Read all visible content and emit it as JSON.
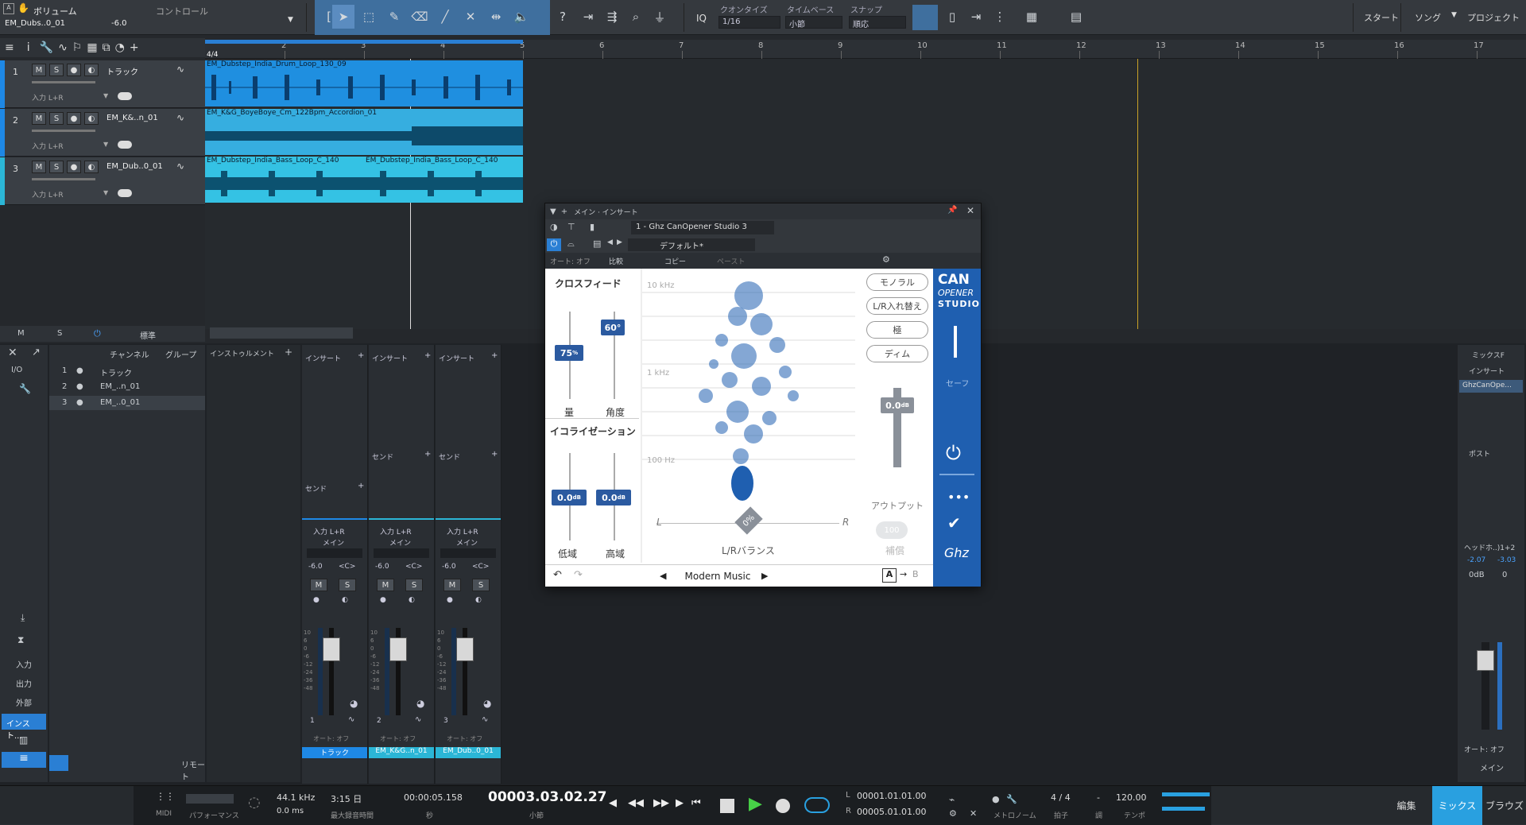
{
  "topbar": {
    "param_label": "ボリューム",
    "control_label": "コントロール",
    "track_label": "EM_Dubs..0_01",
    "param_value": "-6.0",
    "iq_label": "IQ",
    "quantize_label": "クオンタイズ",
    "quantize_value": "1/16",
    "timebase_label": "タイムベース",
    "timebase_value": "小節",
    "snap_label": "スナップ",
    "snap_value": "順応",
    "start_tab": "スタート",
    "song_tab": "ソング",
    "project_tab": "プロジェクト"
  },
  "ruler": {
    "bars": [
      "2",
      "3",
      "4",
      "5",
      "6",
      "7",
      "8",
      "9",
      "10",
      "11",
      "12",
      "13",
      "14",
      "15",
      "16",
      "17"
    ],
    "signature": "4/4"
  },
  "tracks": [
    {
      "num": "1",
      "name": "トラック",
      "input": "入力 L+R",
      "clips": [
        "EM_Dubstep_India_Drum_Loop_130_09"
      ]
    },
    {
      "num": "2",
      "name": "EM_K&..n_01",
      "input": "入力 L+R",
      "clips": [
        "EM_K&G_BoyeBoye_Cm_122Bpm_Accordion_01"
      ]
    },
    {
      "num": "3",
      "name": "EM_Dub..0_01",
      "input": "入力 L+R",
      "clips": [
        "EM_Dubstep_India_Bass_Loop_C_140",
        "EM_Dubstep_India_Bass_Loop_C_140"
      ]
    }
  ],
  "track_footer": {
    "m": "M",
    "s": "S",
    "std": "標準"
  },
  "mixer_left": {
    "io": "I/O",
    "col_channel": "チャンネル",
    "col_group": "グループ",
    "col_instrument": "インストゥルメント",
    "channels": [
      {
        "num": "1",
        "name": "トラック"
      },
      {
        "num": "2",
        "name": "EM_..n_01"
      },
      {
        "num": "3",
        "name": "EM_..0_01"
      }
    ],
    "nav": [
      "入力",
      "出力",
      "外部",
      "インスト...",
      "リモート"
    ]
  },
  "channels": [
    {
      "insert": "インサート",
      "send": "センド",
      "input": "入力 L+R",
      "out": "メイン",
      "vol": "-6.0",
      "pan": "<C>",
      "num": "1",
      "label": "トラック",
      "color": "#1e88e5"
    },
    {
      "insert": "インサート",
      "send": "センド",
      "input": "入力 L+R",
      "out": "メイン",
      "vol": "-6.0",
      "pan": "<C>",
      "num": "2",
      "label": "EM_K&G..n_01",
      "color": "#2bb6d6"
    },
    {
      "insert": "インサート",
      "send": "センド",
      "input": "入力 L+R",
      "out": "メイン",
      "vol": "-6.0",
      "pan": "<C>",
      "num": "3",
      "label": "EM_Dub..0_01",
      "color": "#2bb6d6"
    }
  ],
  "fader_scale": [
    "10",
    "6",
    "0",
    "-6",
    "-12",
    "-24",
    "-36",
    "-48"
  ],
  "main_channel": {
    "mix_label": "ミックスF",
    "insert": "インサート",
    "plugin_slot": "GhzCanOpe...",
    "post": "ポスト",
    "headphone": "ヘッドホ..)1+2",
    "l_val": "-2.07",
    "r_val": "-3.03",
    "db": "0dB",
    "db2": "0",
    "auto": "オート: オフ",
    "label": "メイン"
  },
  "plugin": {
    "title": "メイン · インサート",
    "instance": "1 - Ghz CanOpener Studio 3",
    "preset": "デフォルト*",
    "auto": "オート: オフ",
    "compare": "比較",
    "copy": "コピー",
    "paste": "ペースト",
    "crossfeed": "クロスフィード",
    "amount_val": "75",
    "amount_label": "量",
    "angle_val": "60°",
    "angle_label": "角度",
    "eq": "イコライゼーション",
    "low_val": "0.0",
    "low_label": "低域",
    "high_val": "0.0",
    "high_label": "高域",
    "freq_10k": "10 kHz",
    "freq_1k": "1 kHz",
    "freq_100": "100 Hz",
    "pill_mono": "モノラル",
    "pill_swap": "L/R入れ替え",
    "pill_polar": "極",
    "pill_dim": "ディム",
    "out_val": "0.0",
    "out_label": "アウトプット",
    "comp_val": "100",
    "comp_label": "補償",
    "bal_l": "L",
    "bal_r": "R",
    "bal_val": "0%",
    "bal_label": "L/Rバランス",
    "preset_name": "Modern Music",
    "ab_a": "A",
    "ab_b": "B",
    "brand1": "CAN",
    "brand2": "OPENER",
    "brand3": "STUDIO",
    "safe": "セーフ",
    "logo": "Ghz"
  },
  "transport": {
    "midi": "MIDI",
    "perf": "パフォーマンス",
    "rate": "44.1 kHz",
    "latency": "0.0 ms",
    "rec_time": "3:15 日",
    "rec_label": "最大録音時間",
    "sec_time": "00:00:05.158",
    "sec_label": "秒",
    "bars_time": "00003.03.02.27",
    "bars_label": "小節",
    "loop_l": "00001.01.01.00",
    "loop_r": "00005.01.01.00",
    "metronome": "メトロノーム",
    "signature": "4 / 4",
    "sig_label": "拍子",
    "key": "-",
    "key_label": "調",
    "tempo": "120.00",
    "tempo_label": "テンポ",
    "tab_edit": "編集",
    "tab_mix": "ミックス",
    "tab_browse": "ブラウズ"
  }
}
